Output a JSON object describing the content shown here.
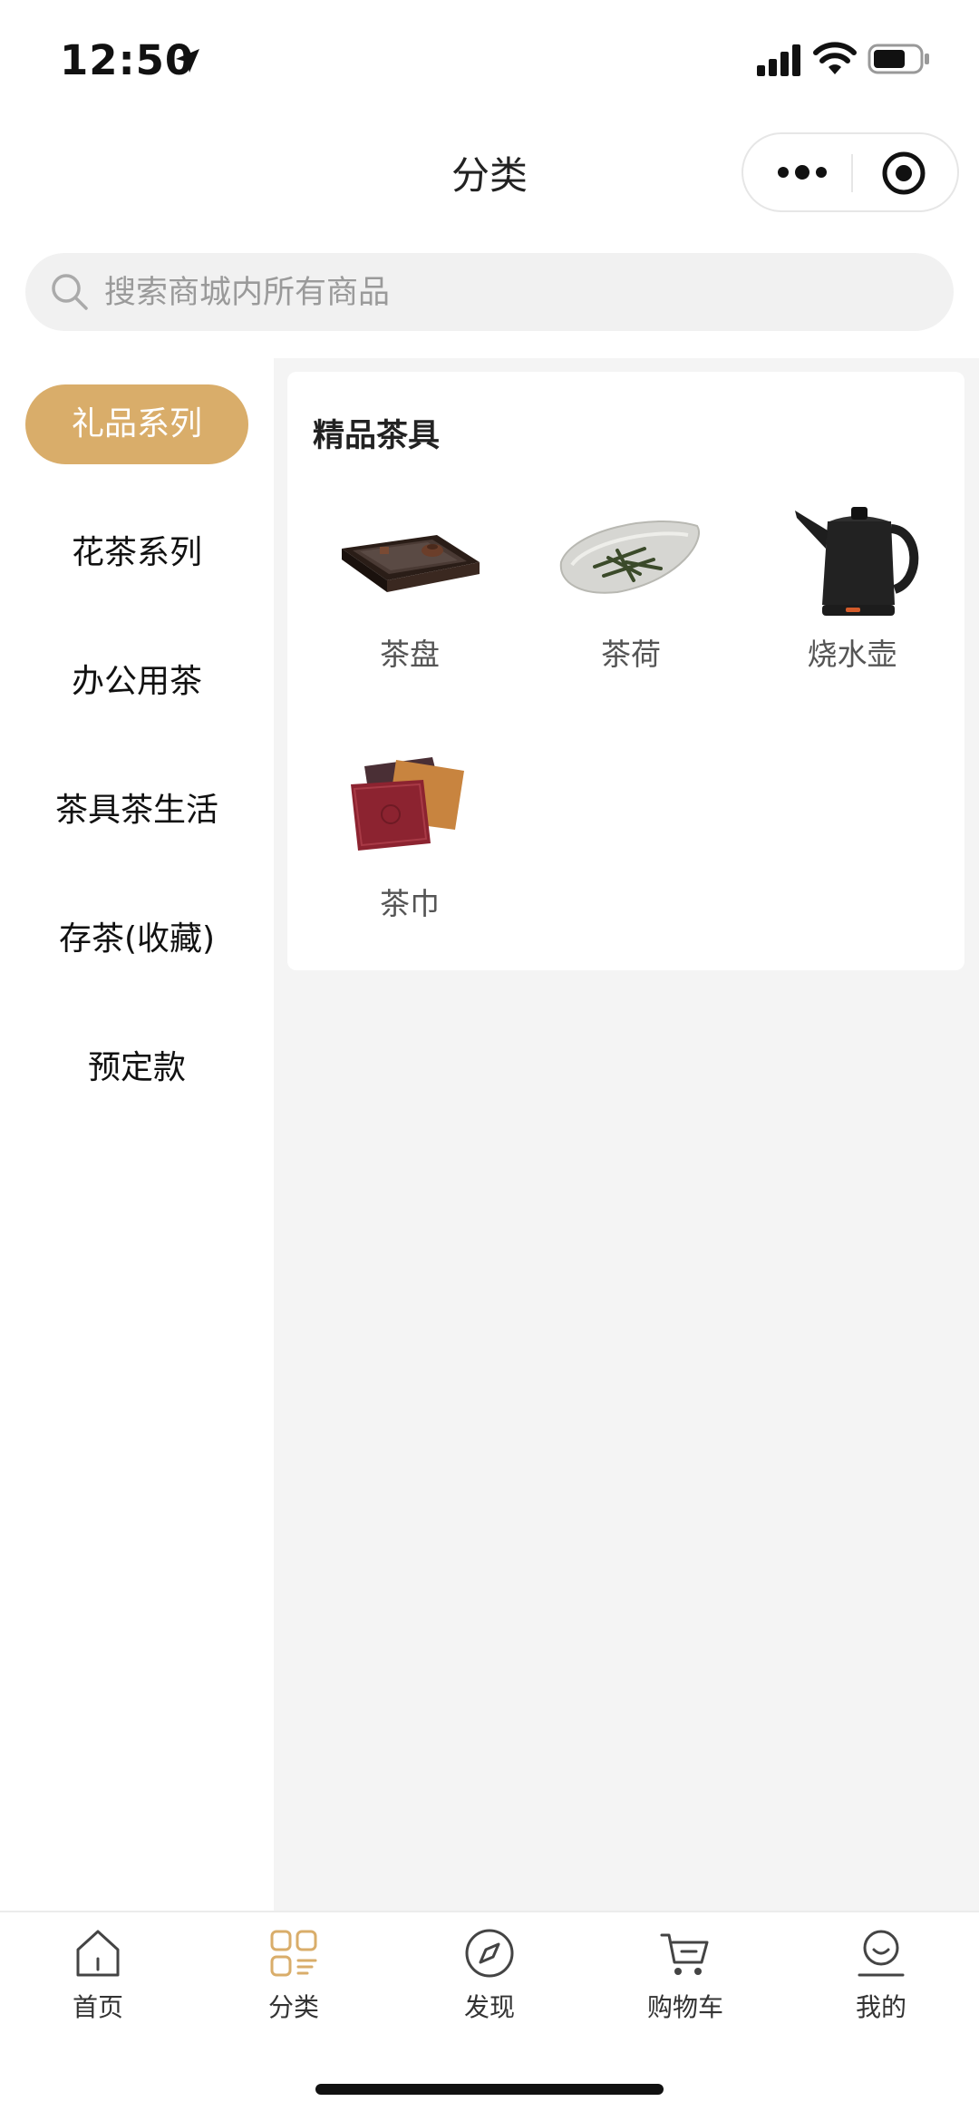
{
  "status_bar": {
    "time": "12:50"
  },
  "nav": {
    "title": "分类"
  },
  "search": {
    "placeholder": "搜索商城内所有商品"
  },
  "sidebar": {
    "items": [
      {
        "label": "礼品系列",
        "active": true
      },
      {
        "label": "花茶系列",
        "active": false
      },
      {
        "label": "办公用茶",
        "active": false
      },
      {
        "label": "茶具茶生活",
        "active": false
      },
      {
        "label": "存茶(收藏)",
        "active": false
      },
      {
        "label": "预定款",
        "active": false
      }
    ]
  },
  "content": {
    "section_title": "精品茶具",
    "products": [
      {
        "label": "茶盘",
        "icon": "tea-tray-image"
      },
      {
        "label": "茶荷",
        "icon": "tea-holder-image"
      },
      {
        "label": "烧水壶",
        "icon": "kettle-image"
      },
      {
        "label": "茶巾",
        "icon": "tea-towel-image"
      }
    ]
  },
  "tabbar": {
    "items": [
      {
        "label": "首页",
        "icon": "home-icon"
      },
      {
        "label": "分类",
        "icon": "category-icon",
        "active": true
      },
      {
        "label": "发现",
        "icon": "compass-icon"
      },
      {
        "label": "购物车",
        "icon": "cart-icon"
      },
      {
        "label": "我的",
        "icon": "profile-icon"
      }
    ]
  },
  "colors": {
    "accent": "#d9ad6a",
    "content_bg": "#f4f4f4"
  }
}
